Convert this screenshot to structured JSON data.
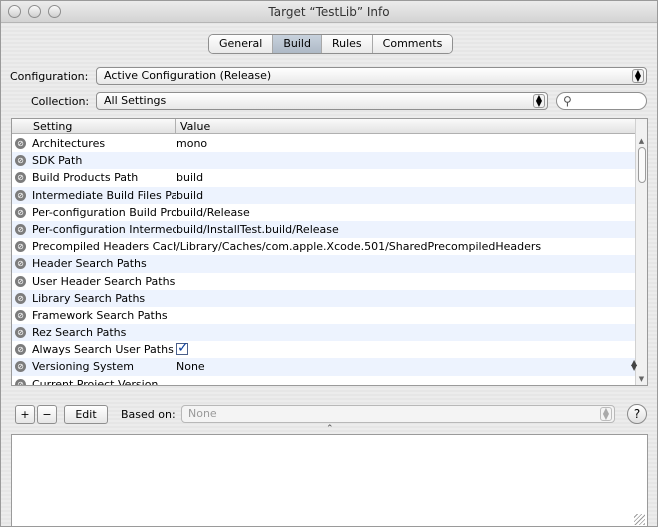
{
  "window": {
    "title": "Target “TestLib” Info"
  },
  "tabs": [
    {
      "label": "General"
    },
    {
      "label": "Build"
    },
    {
      "label": "Rules"
    },
    {
      "label": "Comments"
    }
  ],
  "active_tab": "Build",
  "configuration": {
    "label": "Configuration:",
    "value": "Active Configuration (Release)"
  },
  "collection": {
    "label": "Collection:",
    "value": "All Settings"
  },
  "search": {
    "placeholder": ""
  },
  "table": {
    "headers": {
      "setting": "Setting",
      "value": "Value"
    },
    "rows": [
      {
        "setting": "Architectures",
        "value": "mono"
      },
      {
        "setting": "SDK Path",
        "value": ""
      },
      {
        "setting": "Build Products Path",
        "value": "build"
      },
      {
        "setting": "Intermediate Build Files Path",
        "value": "build"
      },
      {
        "setting": "Per-configuration Build Products Path",
        "value": "build/Release"
      },
      {
        "setting": "Per-configuration Intermediate Build Files Path",
        "value": "build/InstallTest.build/Release"
      },
      {
        "setting": "Precompiled Headers Cache Path",
        "value": "/Library/Caches/com.apple.Xcode.501/SharedPrecompiledHeaders"
      },
      {
        "setting": "Header Search Paths",
        "value": ""
      },
      {
        "setting": "User Header Search Paths",
        "value": ""
      },
      {
        "setting": "Library Search Paths",
        "value": ""
      },
      {
        "setting": "Framework Search Paths",
        "value": ""
      },
      {
        "setting": "Rez Search Paths",
        "value": ""
      },
      {
        "setting": "Always Search User Paths",
        "value": "",
        "checkbox": true
      },
      {
        "setting": "Versioning System",
        "value": "None"
      },
      {
        "setting": "Current Project Version",
        "value": ""
      }
    ]
  },
  "toolbar": {
    "add_label": "+",
    "remove_label": "−",
    "edit_label": "Edit",
    "based_on_label": "Based on:",
    "based_on_value": "None",
    "help_label": "?"
  }
}
